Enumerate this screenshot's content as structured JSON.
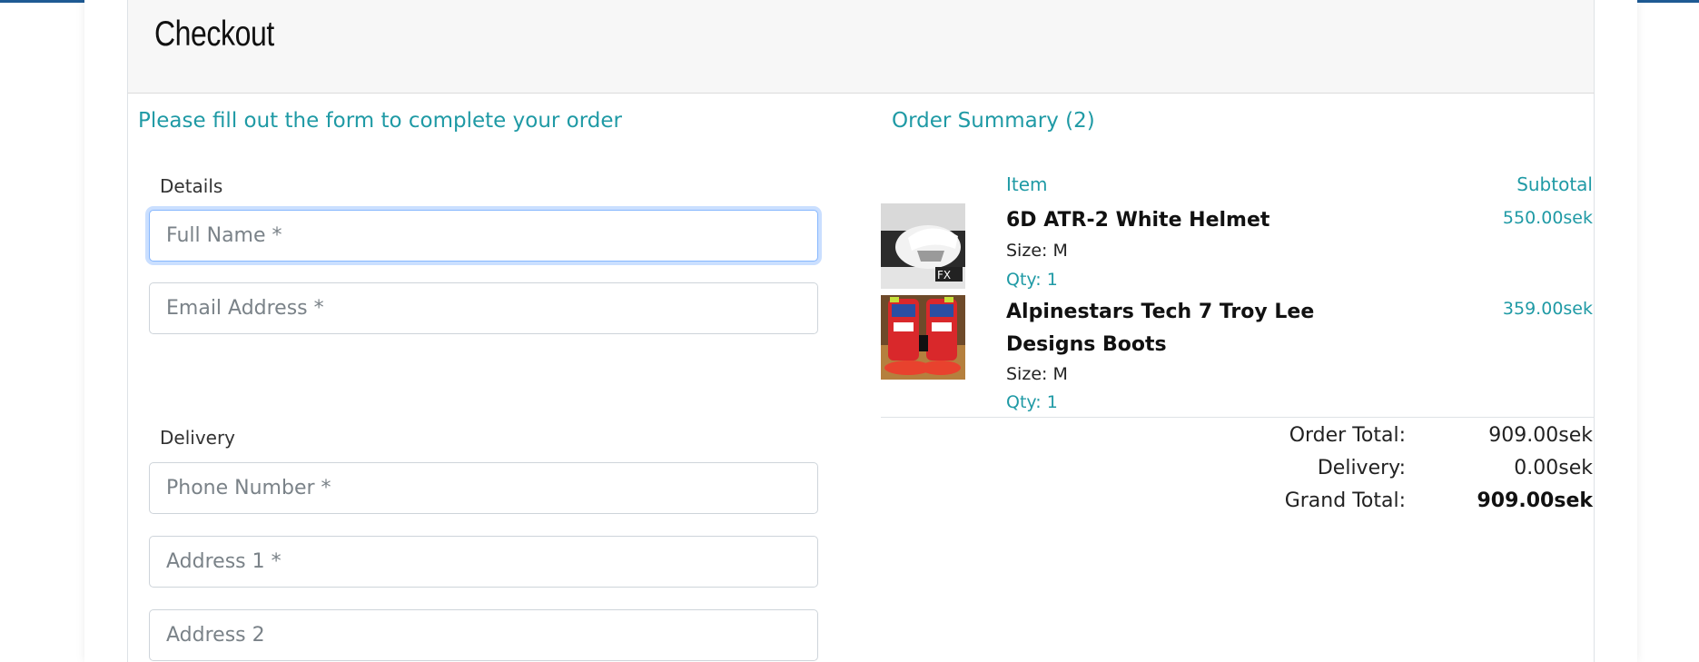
{
  "page": {
    "title": "Checkout",
    "accent_color": "#1f9aa5",
    "top_bar_color": "#1e5a93"
  },
  "form": {
    "heading": "Please fill out the form to complete your order",
    "details_label": "Details",
    "delivery_label": "Delivery",
    "fields": {
      "full_name": {
        "placeholder": "Full Name *",
        "value": ""
      },
      "email": {
        "placeholder": "Email Address *",
        "value": ""
      },
      "phone": {
        "placeholder": "Phone Number *",
        "value": ""
      },
      "address1": {
        "placeholder": "Address 1 *",
        "value": ""
      },
      "address2": {
        "placeholder": "Address 2",
        "value": ""
      }
    }
  },
  "summary": {
    "heading": "Order Summary (2)",
    "col_item": "Item",
    "col_subtotal": "Subtotal",
    "items": [
      {
        "name": "6D ATR-2 White Helmet",
        "size": "Size: M",
        "qty": "Qty: 1",
        "subtotal": "550.00sek",
        "image_icon": "helmet-image"
      },
      {
        "name": "Alpinestars Tech 7 Troy Lee Designs Boots",
        "size": "Size: M",
        "qty": "Qty: 1",
        "subtotal": "359.00sek",
        "image_icon": "boots-image"
      }
    ],
    "totals": {
      "order_total_label": "Order Total:",
      "order_total_value": "909.00sek",
      "delivery_label": "Delivery:",
      "delivery_value": "0.00sek",
      "grand_total_label": "Grand Total:",
      "grand_total_value": "909.00sek"
    }
  }
}
